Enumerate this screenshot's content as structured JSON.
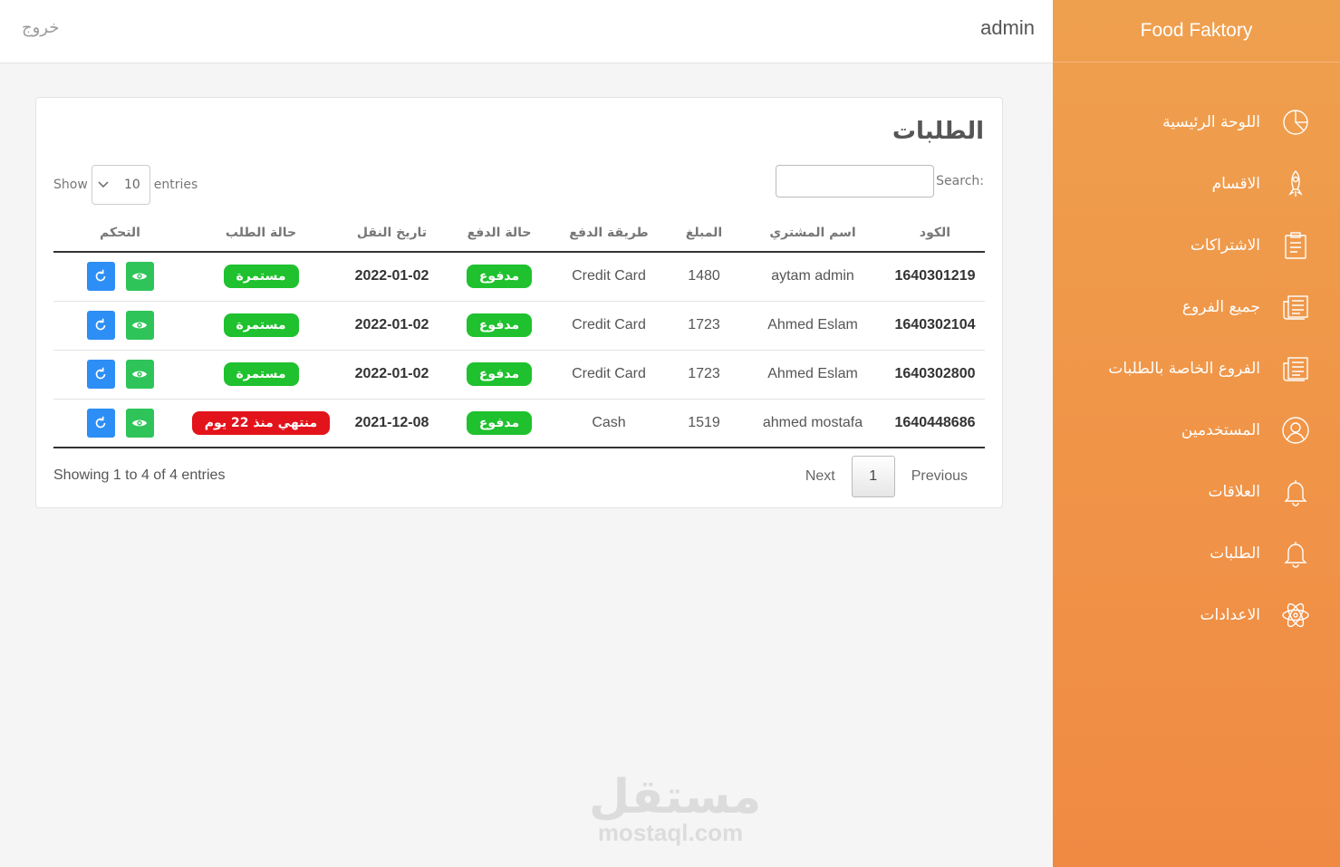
{
  "brand": "Food Faktory",
  "topbar": {
    "logout": "خروج",
    "user": "admin"
  },
  "sidebar": {
    "items": [
      {
        "label": "اللوحة الرئيسية",
        "icon": "pie-chart-icon"
      },
      {
        "label": "الاقسام",
        "icon": "rocket-icon"
      },
      {
        "label": "الاشتراكات",
        "icon": "clipboard-icon"
      },
      {
        "label": "جميع الفروع",
        "icon": "newspaper-icon"
      },
      {
        "label": "الفروع الخاصة بالطلبات",
        "icon": "newspaper-icon"
      },
      {
        "label": "المستخدمين",
        "icon": "user-icon"
      },
      {
        "label": "العلاقات",
        "icon": "bell-icon"
      },
      {
        "label": "الطلبات",
        "icon": "bell-icon"
      },
      {
        "label": "الاعدادات",
        "icon": "atom-icon"
      }
    ]
  },
  "main": {
    "title": "الطلبات",
    "show_label": "Show",
    "entries_value": "10",
    "entries_label": "entries",
    "search_label": "Search:",
    "columns": [
      "الكود",
      "اسم المشتري",
      "المبلغ",
      "طريقة الدفع",
      "حالة الدفع",
      "تاريخ النقل",
      "حالة الطلب",
      "التحكم"
    ],
    "rows": [
      {
        "code": "1640301219",
        "buyer": "aytam admin",
        "amount": "1480",
        "method": "Credit Card",
        "paid": "مدفوع",
        "date": "2022-01-02",
        "status": "مستمرة",
        "status_color": "green"
      },
      {
        "code": "1640302104",
        "buyer": "Ahmed Eslam",
        "amount": "1723",
        "method": "Credit Card",
        "paid": "مدفوع",
        "date": "2022-01-02",
        "status": "مستمرة",
        "status_color": "green"
      },
      {
        "code": "1640302800",
        "buyer": "Ahmed Eslam",
        "amount": "1723",
        "method": "Credit Card",
        "paid": "مدفوع",
        "date": "2022-01-02",
        "status": "مستمرة",
        "status_color": "green"
      },
      {
        "code": "1640448686",
        "buyer": "ahmed mostafa",
        "amount": "1519",
        "method": "Cash",
        "paid": "مدفوع",
        "date": "2021-12-08",
        "status": "منتهي منذ 22 يوم",
        "status_color": "red"
      }
    ],
    "info": "Showing 1 to 4 of 4 entries",
    "pager": {
      "previous": "Previous",
      "page": "1",
      "next": "Next"
    }
  },
  "watermark": {
    "arabic": "مستقل",
    "latin": "mostaql.com"
  },
  "colors": {
    "sidebar_top": "#efa04e",
    "sidebar_bottom": "#f08a43",
    "green": "#1fc12e",
    "red": "#e3131b",
    "blue": "#2d8ef5"
  }
}
